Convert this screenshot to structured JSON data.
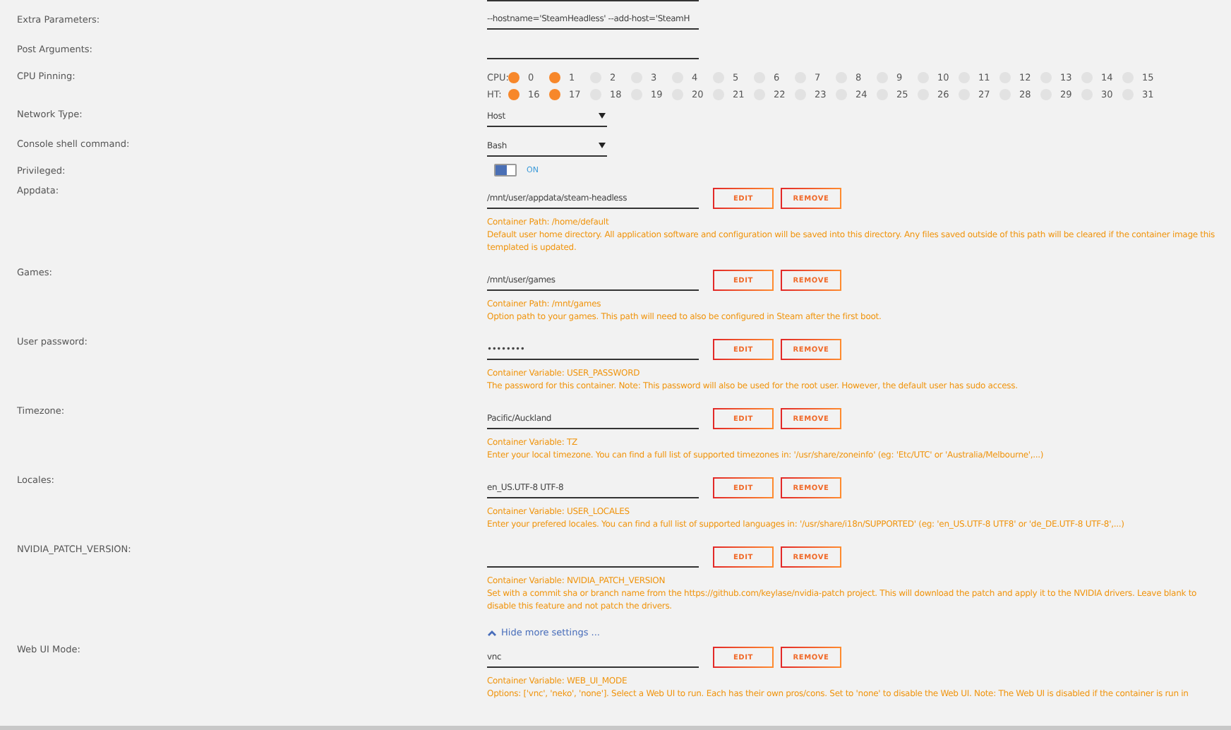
{
  "settings": [
    {
      "kind": "text",
      "label": "Extra Parameters:",
      "value": "--hostname='SteamHeadless' --add-host='SteamH"
    },
    {
      "kind": "text",
      "label": "Post Arguments:"
    },
    {
      "kind": "cpu_pinning",
      "label": "CPU Pinning:",
      "rows": [
        {
          "label": "CPU:",
          "cores": [
            {
              "number": "0",
              "selected": true
            },
            {
              "number": "1",
              "selected": true
            },
            {
              "number": "2",
              "selected": false
            },
            {
              "number": "3",
              "selected": false
            },
            {
              "number": "4",
              "selected": false
            },
            {
              "number": "5",
              "selected": false
            },
            {
              "number": "6",
              "selected": false
            },
            {
              "number": "7",
              "selected": false
            },
            {
              "number": "8",
              "selected": false
            },
            {
              "number": "9",
              "selected": false
            },
            {
              "number": "10",
              "selected": false
            },
            {
              "number": "11",
              "selected": false
            },
            {
              "number": "12",
              "selected": false
            },
            {
              "number": "13",
              "selected": false
            },
            {
              "number": "14",
              "selected": false
            },
            {
              "number": "15",
              "selected": false
            }
          ]
        },
        {
          "label": "HT:",
          "cores": [
            {
              "number": "16",
              "selected": true
            },
            {
              "number": "17",
              "selected": true
            },
            {
              "number": "18",
              "selected": false
            },
            {
              "number": "19",
              "selected": false
            },
            {
              "number": "20",
              "selected": false
            },
            {
              "number": "21",
              "selected": false
            },
            {
              "number": "22",
              "selected": false
            },
            {
              "number": "23",
              "selected": false
            },
            {
              "number": "24",
              "selected": false
            },
            {
              "number": "25",
              "selected": false
            },
            {
              "number": "26",
              "selected": false
            },
            {
              "number": "27",
              "selected": false
            },
            {
              "number": "28",
              "selected": false
            },
            {
              "number": "29",
              "selected": false
            },
            {
              "number": "30",
              "selected": false
            },
            {
              "number": "31",
              "selected": false
            }
          ]
        }
      ]
    },
    {
      "kind": "select",
      "label": "Network Type:",
      "value": "Host"
    },
    {
      "kind": "select",
      "label": "Console shell command:",
      "value": "Bash"
    },
    {
      "kind": "toggle",
      "label": "Privileged:",
      "on": true,
      "state_text": "ON"
    },
    {
      "kind": "config",
      "label": "Appdata:",
      "value": "/mnt/user/appdata/steam-headless",
      "buttons": [
        "EDIT",
        "REMOVE"
      ],
      "description_title": "Container Path: /home/default",
      "description": "Default user home directory. All application software and configuration will be saved into this directory. Any files saved outside of this path will be cleared if the container image this templated is updated."
    },
    {
      "kind": "config",
      "label": "Games:",
      "value": "/mnt/user/games",
      "buttons": [
        "EDIT",
        "REMOVE"
      ],
      "description_title": "Container Path: /mnt/games",
      "description": "Option path to your games. This path will need to also be configured in Steam after the first boot."
    },
    {
      "kind": "config",
      "label": "User password:",
      "value": "••••••••",
      "buttons": [
        "EDIT",
        "REMOVE"
      ],
      "description_title": "Container Variable: USER_PASSWORD",
      "description": "The password for this container. Note: This password will also be used for the root user. However, the default user has sudo access."
    },
    {
      "kind": "config",
      "label": "Timezone:",
      "value": "Pacific/Auckland",
      "buttons": [
        "EDIT",
        "REMOVE"
      ],
      "description_title": "Container Variable: TZ",
      "description": "Enter your local timezone. You can find a full list of supported timezones in: '/usr/share/zoneinfo' (eg: 'Etc/UTC' or 'Australia/Melbourne',...)"
    },
    {
      "kind": "config",
      "label": "Locales:",
      "value": "en_US.UTF-8 UTF-8",
      "buttons": [
        "EDIT",
        "REMOVE"
      ],
      "description_title": "Container Variable: USER_LOCALES",
      "description": "Enter your prefered locales. You can find a full list of supported languages in: '/usr/share/i18n/SUPPORTED' (eg: 'en_US.UTF-8 UTF8' or 'de_DE.UTF-8 UTF-8',...)"
    },
    {
      "kind": "config",
      "label": "NVIDIA_PATCH_VERSION:",
      "buttons": [
        "EDIT",
        "REMOVE"
      ],
      "description_title": "Container Variable: NVIDIA_PATCH_VERSION",
      "description": "Set with a commit sha or branch name from the https://github.com/keylase/nvidia-patch project. This will download the patch and apply it to the NVIDIA drivers. Leave blank to disable this feature and not patch the drivers."
    },
    {
      "kind": "link",
      "text": "Hide more settings ..."
    },
    {
      "kind": "config",
      "label": "Web UI Mode:",
      "value": "vnc",
      "buttons": [
        "EDIT",
        "REMOVE"
      ],
      "description_title": "Container Variable: WEB_UI_MODE",
      "description": "Options: ['vnc', 'neko', 'none']. Select a Web UI to run. Each has their own pros/cons. Set to 'none' to disable the Web UI. Note: The Web UI is disabled if the container is run in"
    }
  ]
}
